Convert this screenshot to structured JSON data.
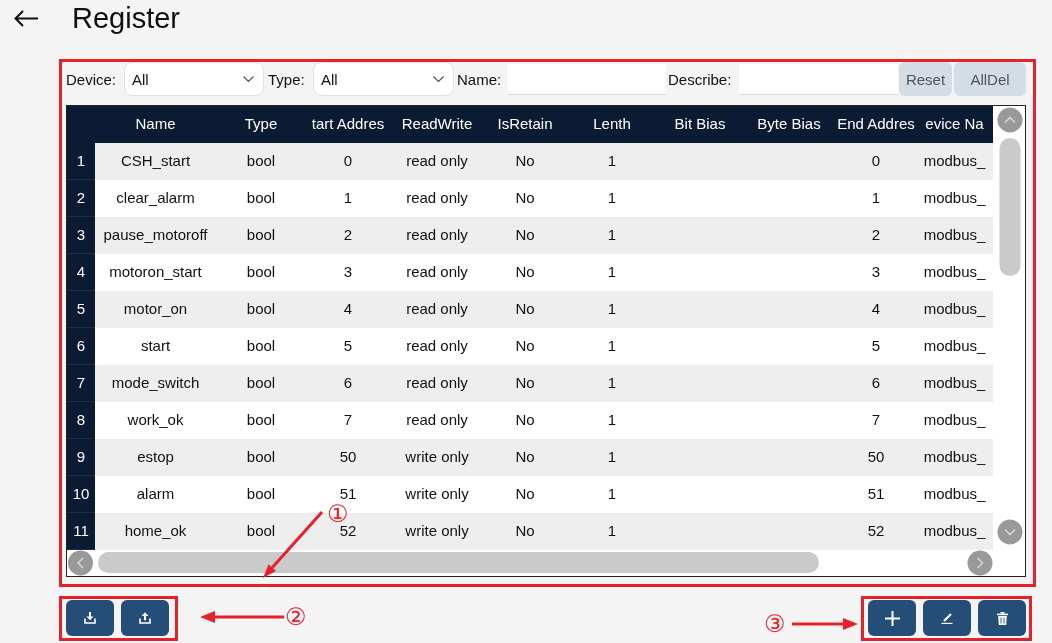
{
  "page": {
    "title": "Register"
  },
  "filters": {
    "device": {
      "label": "Device:",
      "value": "All"
    },
    "type": {
      "label": "Type:",
      "value": "All"
    },
    "name": {
      "label": "Name:"
    },
    "describe": {
      "label": "Describe:"
    },
    "buttons": [
      "Reset",
      "AllDel"
    ]
  },
  "table": {
    "columns": [
      {
        "label": "Name"
      },
      {
        "label": "Type"
      },
      {
        "label": "tart Addres"
      },
      {
        "label": "ReadWrite"
      },
      {
        "label": "IsRetain"
      },
      {
        "label": "Lenth"
      },
      {
        "label": "Bit Bias"
      },
      {
        "label": "Byte Bias"
      },
      {
        "label": "End Addres"
      },
      {
        "label": "evice Na"
      }
    ],
    "rows": [
      {
        "index": "1",
        "name": "CSH_start",
        "type": "bool",
        "column_3": "0",
        "read_write": "read only",
        "is_retain": "No",
        "lenth": "1",
        "column_9": "0",
        "column_10": "modbus_"
      },
      {
        "index": "2",
        "name": "clear_alarm",
        "type": "bool",
        "column_3": "1",
        "read_write": "read only",
        "is_retain": "No",
        "lenth": "1",
        "column_9": "1",
        "column_10": "modbus_"
      },
      {
        "index": "3",
        "name": "pause_motoroff",
        "type": "bool",
        "column_3": "2",
        "read_write": "read only",
        "is_retain": "No",
        "lenth": "1",
        "column_9": "2",
        "column_10": "modbus_"
      },
      {
        "index": "4",
        "name": "motoron_start",
        "type": "bool",
        "column_3": "3",
        "read_write": "read only",
        "is_retain": "No",
        "lenth": "1",
        "column_9": "3",
        "column_10": "modbus_"
      },
      {
        "index": "5",
        "name": "motor_on",
        "type": "bool",
        "column_3": "4",
        "read_write": "read only",
        "is_retain": "No",
        "lenth": "1",
        "column_9": "4",
        "column_10": "modbus_"
      },
      {
        "index": "6",
        "name": "start",
        "type": "bool",
        "column_3": "5",
        "read_write": "read only",
        "is_retain": "No",
        "lenth": "1",
        "column_9": "5",
        "column_10": "modbus_"
      },
      {
        "index": "7",
        "name": "mode_switch",
        "type": "bool",
        "column_3": "6",
        "read_write": "read only",
        "is_retain": "No",
        "lenth": "1",
        "column_9": "6",
        "column_10": "modbus_"
      },
      {
        "index": "8",
        "name": "work_ok",
        "type": "bool",
        "column_3": "7",
        "read_write": "read only",
        "is_retain": "No",
        "lenth": "1",
        "column_9": "7",
        "column_10": "modbus_"
      },
      {
        "index": "9",
        "name": "estop",
        "type": "bool",
        "column_3": "50",
        "read_write": "write only",
        "is_retain": "No",
        "lenth": "1",
        "column_9": "50",
        "column_10": "modbus_"
      },
      {
        "index": "10",
        "name": "alarm",
        "type": "bool",
        "column_3": "51",
        "read_write": "write only",
        "is_retain": "No",
        "lenth": "1",
        "column_9": "51",
        "column_10": "modbus_"
      },
      {
        "index": "11",
        "name": "home_ok",
        "type": "bool",
        "column_3": "52",
        "read_write": "write only",
        "is_retain": "No",
        "lenth": "1",
        "column_9": "52",
        "column_10": "modbus_"
      }
    ]
  },
  "annotations": {
    "markers": [
      "①",
      "②",
      "③"
    ]
  }
}
